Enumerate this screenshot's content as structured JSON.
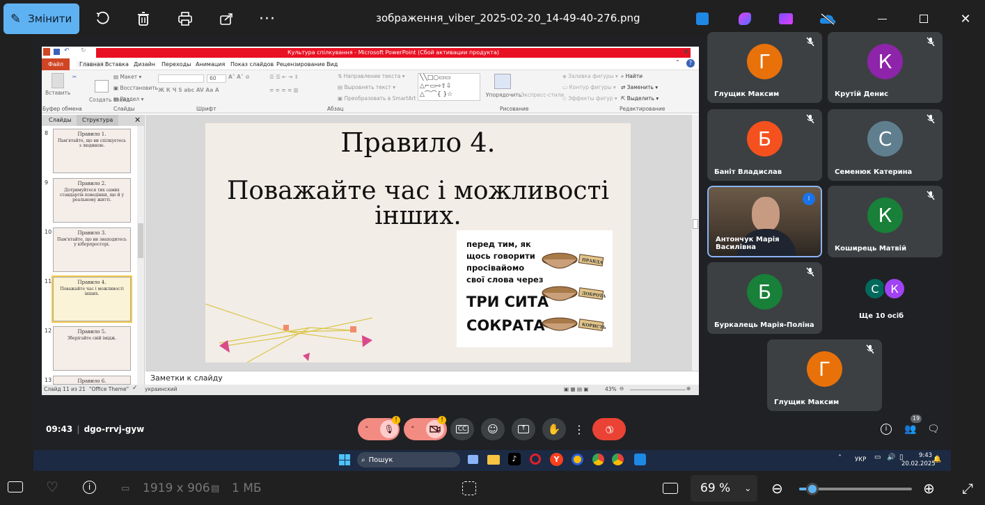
{
  "viewer": {
    "edit_label": "Змінити",
    "file_title": "зображення_viber_2025-02-20_14-49-40-276.png",
    "dimensions": "1919 x 906",
    "size": "1 МБ",
    "zoom": "69 %"
  },
  "ppt": {
    "window_title": "Культура спілкування - Microsoft PowerPoint (Сбой активации продукта)",
    "tabs": [
      "Файл",
      "Главная",
      "Вставка",
      "Дизайн",
      "Переходы",
      "Анимация",
      "Показ слайдов",
      "Рецензирование",
      "Вид"
    ],
    "ribbon": {
      "paste": "Вставить",
      "new_slide": "Создать слайд",
      "layout": "Макет",
      "reset": "Восстановить",
      "section": "Раздел",
      "font_size": "60",
      "text_direction": "Направление текста",
      "align_text": "Выровнять текст",
      "smartart": "Преобразовать в SmartArt",
      "arrange": "Упорядочить",
      "quick_styles": "Экспресс-стили",
      "fill": "Заливка фигуры",
      "outline": "Контур фигуры",
      "effects": "Эффекты фигур",
      "find": "Найти",
      "replace": "Заменить",
      "select": "Выделить",
      "groups": [
        "Буфер обмена",
        "Слайды",
        "Шрифт",
        "Абзац",
        "Рисование",
        "Редактирование"
      ]
    },
    "panel_tabs": [
      "Слайды",
      "Структура"
    ],
    "thumbnails": [
      {
        "num": "8",
        "title": "Правило 1.",
        "text": "Пам'ятайте, що ви спілкуєтесь з людиною."
      },
      {
        "num": "9",
        "title": "Правило 2.",
        "text": "Дотримуйтеся тих самих стандартів поведінки, що й у реальному житті."
      },
      {
        "num": "10",
        "title": "Правило 3.",
        "text": "Пам'ятайте, що ви знаходитесь у кіберпросторі."
      },
      {
        "num": "11",
        "title": "Правило 4.",
        "text": "Поважайте час і можливості інших."
      },
      {
        "num": "12",
        "title": "Правило 5.",
        "text": "Зберігайте свій імідж."
      },
      {
        "num": "13",
        "title": "Правило 6.",
        "text": ""
      }
    ],
    "slide": {
      "title": "Правило 4.",
      "body": "Поважайте час і можливості інших.",
      "card_lines": [
        "перед тим, як",
        "щось говорити",
        "просівайомо",
        "свої слова через"
      ],
      "card_big": [
        "ТРИ СИТА",
        "СОКРАТА"
      ],
      "sieve_labels": [
        "ПРАВДА",
        "ДОБРОТА",
        "КОРИСТЬ"
      ]
    },
    "notes_placeholder": "Заметки к слайду",
    "status": {
      "slide_num": "Слайд 11 из 21",
      "theme": "\"Office Theme\"",
      "lang": "украинский",
      "zoom": "43%"
    }
  },
  "participants": [
    {
      "name": "Глущик Максим",
      "initial": "Г",
      "color": "#e8710a"
    },
    {
      "name": "Крутій Денис",
      "initial": "К",
      "color": "#8e24aa"
    },
    {
      "name": "Баніт Владислав",
      "initial": "Б",
      "color": "#f4511e"
    },
    {
      "name": "Семенюк Катерина",
      "initial": "С",
      "color": "#5f7f8f"
    },
    {
      "name": "Антончук Марія Василівна",
      "initial": "",
      "color": ""
    },
    {
      "name": "Коширець Матвій",
      "initial": "К",
      "color": "#188038"
    },
    {
      "name": "Буркалець Марія-Поліна",
      "initial": "Б",
      "color": "#188038"
    },
    {
      "name": "Ще 10 осіб",
      "initial": "",
      "color": ""
    },
    {
      "name": "Глущик Максим",
      "initial": "Г",
      "color": "#e8710a"
    }
  ],
  "more_people": {
    "a": "С",
    "b": "К"
  },
  "meet": {
    "time": "09:43",
    "code": "dgo-rrvj-gyw",
    "participants_count": "19"
  },
  "taskbar": {
    "search": "Пошук",
    "lang": "УКР",
    "time": "9:43",
    "date": "20.02.2025"
  }
}
